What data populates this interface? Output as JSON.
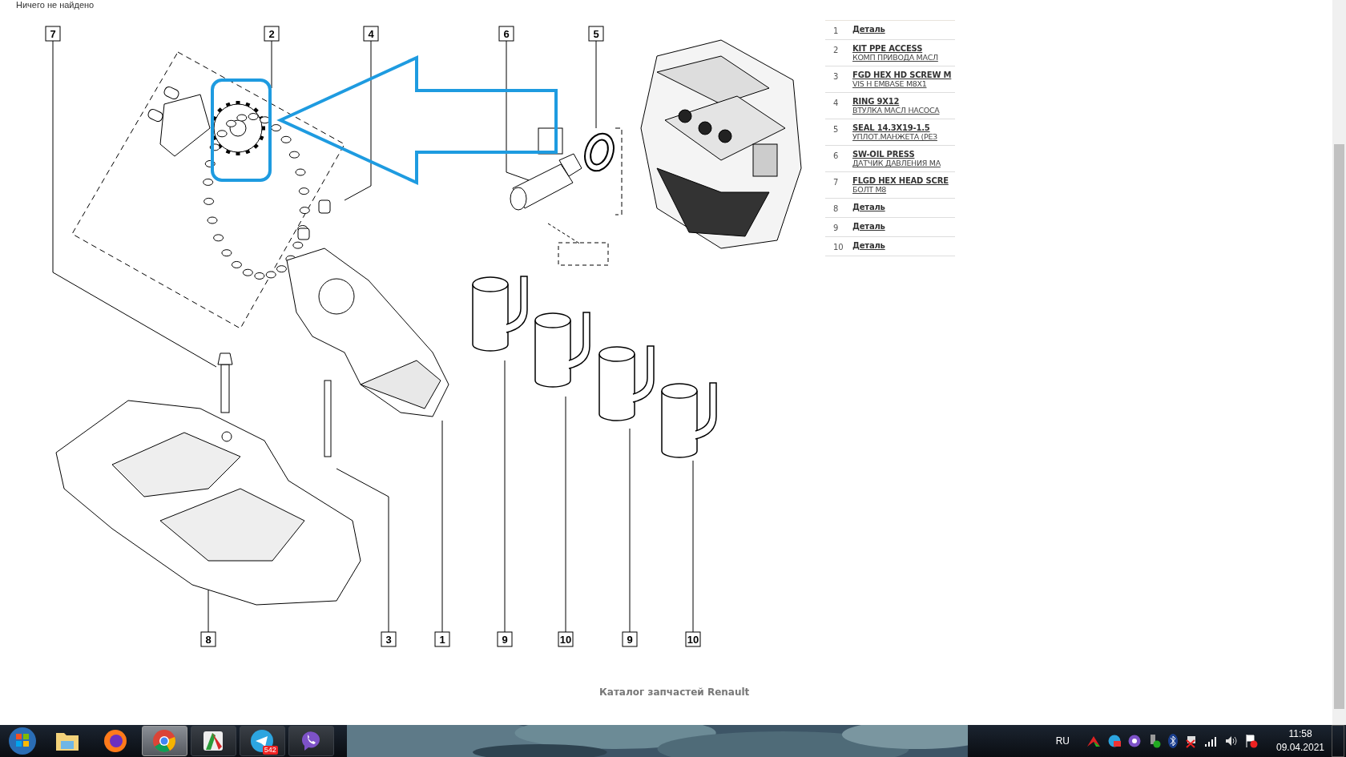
{
  "status_text": "Ничего не найдено",
  "diagram": {
    "callouts": [
      {
        "number": "7"
      },
      {
        "number": "2"
      },
      {
        "number": "4"
      },
      {
        "number": "6"
      },
      {
        "number": "5"
      },
      {
        "number": "8"
      },
      {
        "number": "3"
      },
      {
        "number": "1"
      },
      {
        "number": "9"
      },
      {
        "number": "10"
      },
      {
        "number": "9"
      },
      {
        "number": "10"
      }
    ]
  },
  "parts_list": [
    {
      "number": "1",
      "name": "Деталь"
    },
    {
      "number": "2",
      "name": "KIT PPE ACCESS",
      "subtitle": "КОМП ПРИВОДА МАСЛ"
    },
    {
      "number": "3",
      "name": "FGD HEX HD SCREW M",
      "subtitle": "VIS H EMBASE M8X1"
    },
    {
      "number": "4",
      "name": "RING 9X12",
      "subtitle": "ВТУЛКА МАСЛ НАСОСА"
    },
    {
      "number": "5",
      "name": "SEAL 14.3X19-1.5",
      "subtitle": "УПЛОТ.МАНЖЕТА (РЕЗ"
    },
    {
      "number": "6",
      "name": "SW-OIL PRESS",
      "subtitle": "ДАТЧИК ДАВЛЕНИЯ МА"
    },
    {
      "number": "7",
      "name": "FLGD HEX HEAD SCRE",
      "subtitle": "БОЛТ М8"
    },
    {
      "number": "8",
      "name": "Деталь"
    },
    {
      "number": "9",
      "name": "Деталь"
    },
    {
      "number": "10",
      "name": "Деталь"
    }
  ],
  "footer": "Каталог запчастей Renault",
  "taskbar": {
    "apps": [
      {
        "kind": "explorer",
        "running": false,
        "selected": false
      },
      {
        "kind": "firefox",
        "running": false,
        "selected": false
      },
      {
        "kind": "chrome",
        "running": true,
        "selected": true
      },
      {
        "kind": "screenshot",
        "running": true,
        "selected": false
      },
      {
        "kind": "telegram",
        "running": true,
        "selected": false,
        "badge": "542"
      },
      {
        "kind": "viber",
        "running": true,
        "selected": false
      }
    ],
    "language": "RU",
    "time": "11:58",
    "date": "09.04.2021"
  }
}
